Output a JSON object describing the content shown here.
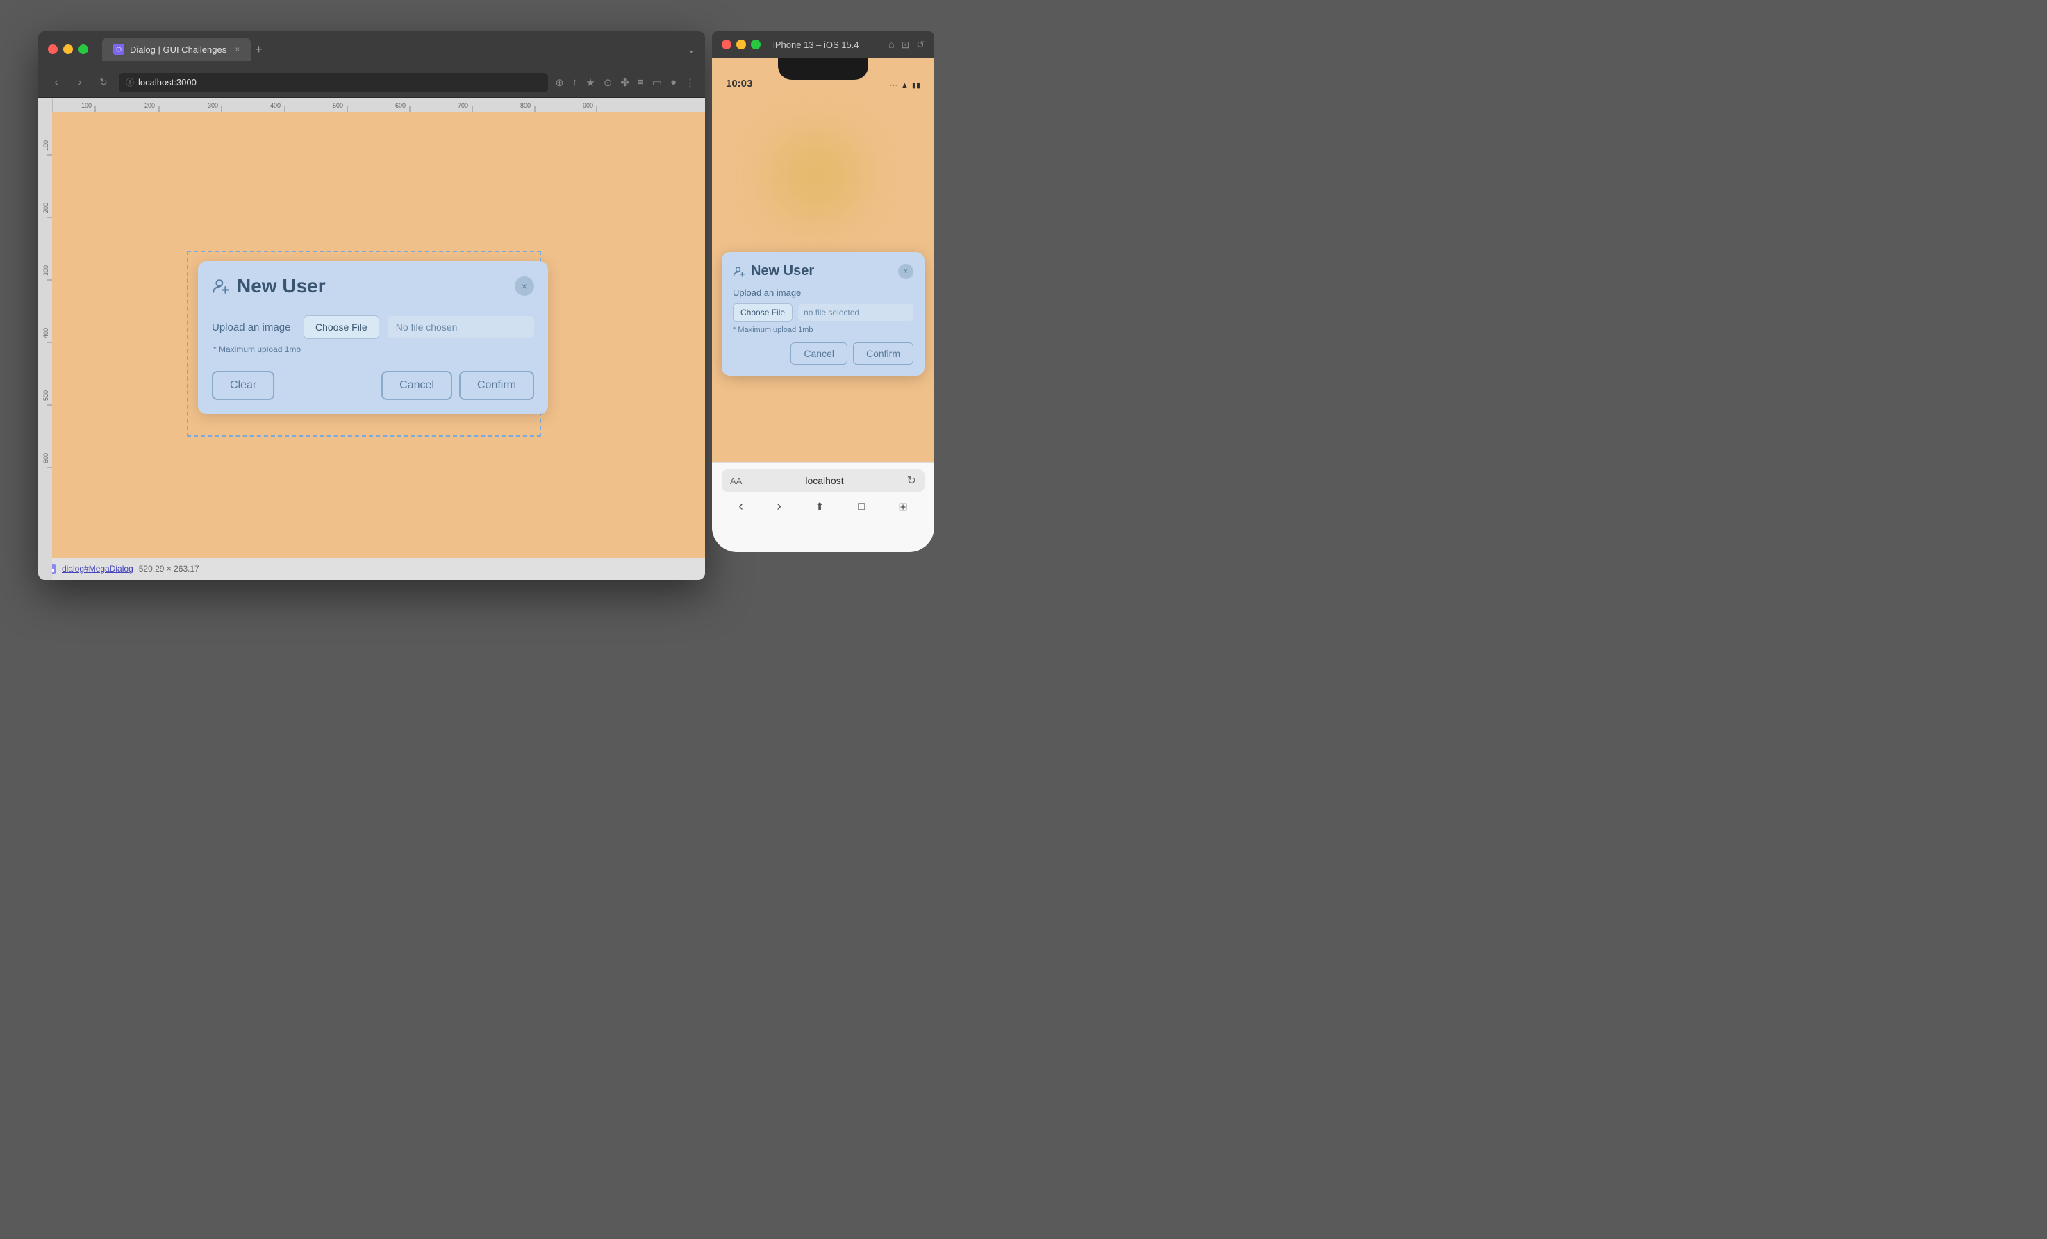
{
  "browser": {
    "traffic_lights": [
      "red",
      "yellow",
      "green"
    ],
    "tab_title": "Dialog | GUI Challenges",
    "tab_close": "×",
    "tab_new": "+",
    "tab_more": "⌄",
    "address": "localhost:3000",
    "toolbar_icons": [
      "⎋",
      "↑",
      "★",
      "⊙",
      "✤",
      "≡",
      "▭",
      "●",
      "⋮"
    ]
  },
  "dialog_desktop": {
    "title": "New User",
    "close_label": "×",
    "upload_label": "Upload an image",
    "choose_file_label": "Choose File",
    "no_file_label": "No file chosen",
    "hint": "* Maximum upload 1mb",
    "clear_label": "Clear",
    "cancel_label": "Cancel",
    "confirm_label": "Confirm"
  },
  "status_bar": {
    "selector": "dialog#MegaDialog",
    "size": "520.29 × 263.17"
  },
  "iphone": {
    "titlebar": "iPhone 13 – iOS 15.4",
    "time": "10:03",
    "signal": "...",
    "wifi": "wifi",
    "battery": "battery"
  },
  "dialog_mobile": {
    "title": "New User",
    "close_label": "×",
    "upload_label": "Upload an image",
    "choose_file_label": "Choose File",
    "no_file_label": "no file selected",
    "hint": "* Maximum upload 1mb",
    "cancel_label": "Cancel",
    "confirm_label": "Confirm"
  },
  "iphone_bottom": {
    "aa_label": "AA",
    "url": "localhost",
    "reload": "↻",
    "nav": [
      "‹",
      "›",
      "⬆",
      "□",
      "⊞"
    ]
  }
}
